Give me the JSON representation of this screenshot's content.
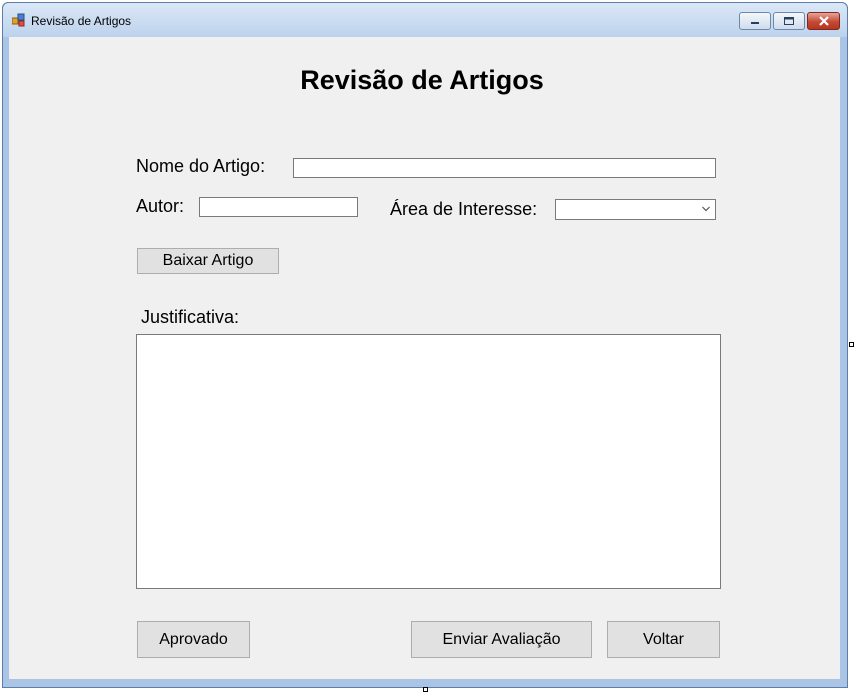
{
  "window": {
    "title": "Revisão de Artigos"
  },
  "form": {
    "heading": "Revisão de Artigos",
    "nome_label": "Nome do Artigo:",
    "nome_value": "",
    "autor_label": "Autor:",
    "autor_value": "",
    "area_label": "Área de Interesse:",
    "area_value": "",
    "baixar_button": "Baixar Artigo",
    "justificativa_label": "Justificativa:",
    "justificativa_value": "",
    "aprovado_button": "Aprovado",
    "enviar_button": "Enviar Avaliação",
    "voltar_button": "Voltar"
  },
  "icons": {
    "app": "app-icon",
    "minimize": "minimize-icon",
    "maximize": "maximize-icon",
    "close": "close-icon",
    "dropdown": "chevron-down-icon"
  },
  "colors": {
    "client_bg": "#f0f0f0",
    "frame": "#a9c4e4",
    "close_button": "#c44a35"
  }
}
